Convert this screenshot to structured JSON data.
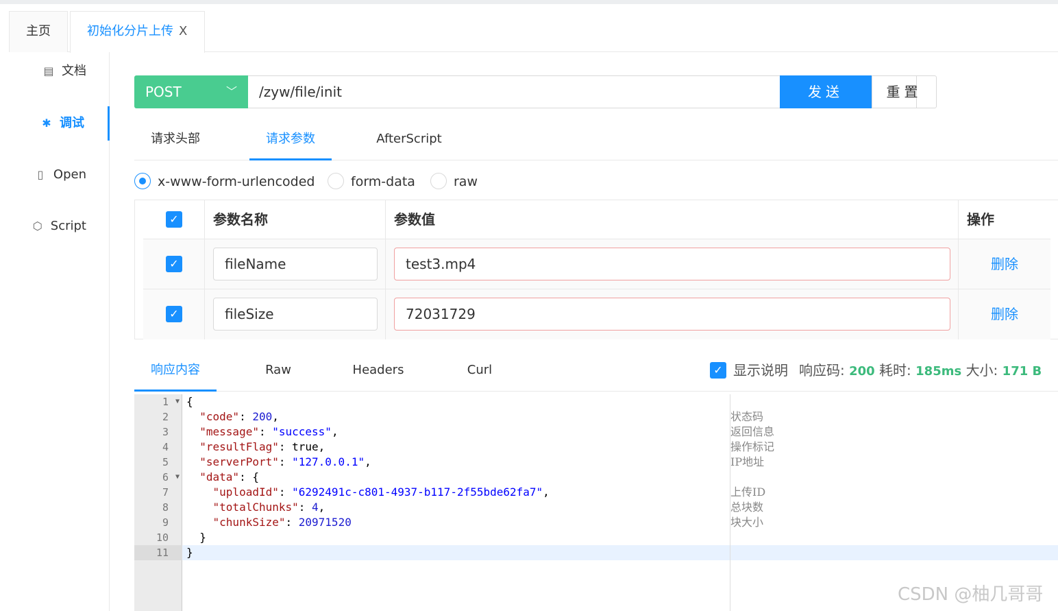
{
  "tabs": {
    "home": "主页",
    "active": "初始化分片上传",
    "close": "X"
  },
  "sidebar": {
    "items": [
      {
        "label": "文档",
        "icon": "document-icon"
      },
      {
        "label": "调试",
        "icon": "bug-icon"
      },
      {
        "label": "Open",
        "icon": "file-icon"
      },
      {
        "label": "Script",
        "icon": "codepen-icon"
      }
    ]
  },
  "request": {
    "method": "POST",
    "url": "/zyw/file/init",
    "send_label": "发送",
    "reset_label": "重置"
  },
  "req_tabs": [
    "请求头部",
    "请求参数",
    "AfterScript"
  ],
  "body_types": [
    "x-www-form-urlencoded",
    "form-data",
    "raw"
  ],
  "params": {
    "headers": {
      "name": "参数名称",
      "value": "参数值",
      "op": "操作"
    },
    "rows": [
      {
        "name": "fileName",
        "value": "test3.mp4",
        "delete": "删除"
      },
      {
        "name": "fileSize",
        "value": "72031729",
        "delete": "删除"
      }
    ]
  },
  "response": {
    "tabs": [
      "响应内容",
      "Raw",
      "Headers",
      "Curl"
    ],
    "show_desc": "显示说明",
    "code_label": "响应码:",
    "code": "200",
    "time_label": "耗时:",
    "time": "185ms",
    "size_label": "大小:",
    "size": "171 B",
    "line_numbers": [
      "1",
      "2",
      "3",
      "4",
      "5",
      "6",
      "7",
      "8",
      "9",
      "10",
      "11"
    ],
    "json": {
      "code": "200",
      "message": "\"success\"",
      "resultFlag": "true",
      "serverPort": "\"127.0.0.1\"",
      "uploadId": "\"6292491c-c801-4937-b117-2f55bde62fa7\"",
      "totalChunks": "4",
      "chunkSize": "20971520"
    },
    "notes": [
      "状态码",
      "返回信息",
      "操作标记",
      "IP地址",
      "上传ID",
      "总块数",
      "块大小"
    ]
  },
  "watermark": "CSDN @柚几哥哥"
}
